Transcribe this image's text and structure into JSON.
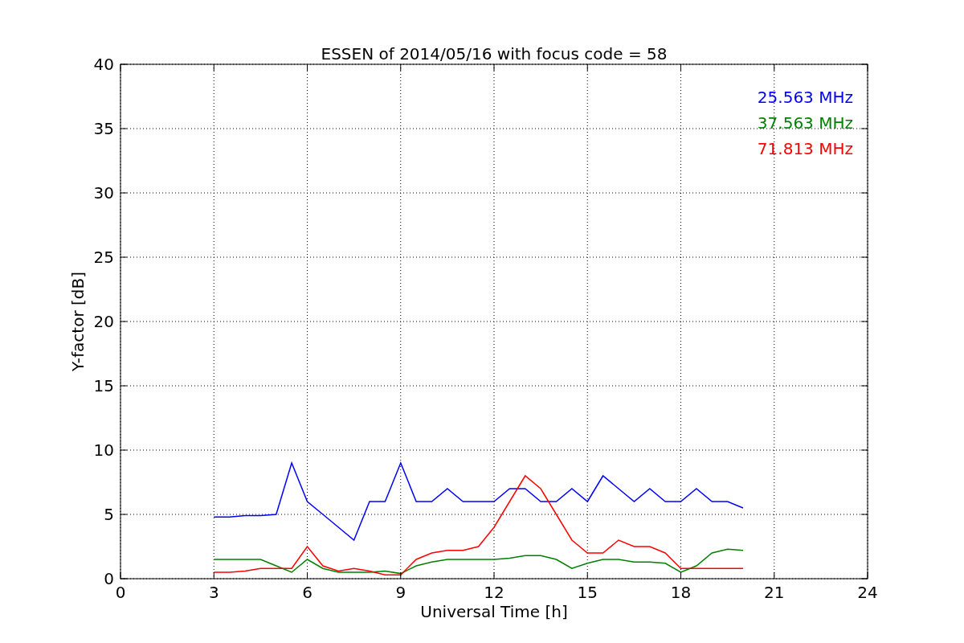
{
  "chart_data": {
    "type": "line",
    "title": "ESSEN of 2014/05/16 with focus code = 58",
    "xlabel": "Universal Time [h]",
    "ylabel": "Y-factor [dB]",
    "x": [
      3,
      3.5,
      4,
      4.5,
      5,
      5.5,
      6,
      6.5,
      7,
      7.5,
      8,
      8.5,
      9,
      9.5,
      10,
      10.5,
      11,
      11.5,
      12,
      12.5,
      13,
      13.5,
      14,
      14.5,
      15,
      15.5,
      16,
      16.5,
      17,
      17.5,
      18,
      18.5,
      19,
      19.5,
      20
    ],
    "series": [
      {
        "name": "25.563 MHz",
        "color": "#0000ff",
        "values": [
          4.8,
          4.8,
          4.9,
          4.9,
          5.0,
          9,
          6,
          5,
          4,
          3,
          6,
          6,
          9,
          6,
          6,
          7,
          6,
          6,
          6,
          7,
          7,
          6,
          6,
          7,
          6,
          8,
          7,
          6,
          7,
          6,
          6,
          7,
          6,
          6,
          5.5
        ]
      },
      {
        "name": "37.563 MHz",
        "color": "#008000",
        "values": [
          1.5,
          1.5,
          1.5,
          1.5,
          1.0,
          0.5,
          1.5,
          0.8,
          0.5,
          0.5,
          0.5,
          0.6,
          0.4,
          1.0,
          1.3,
          1.5,
          1.5,
          1.5,
          1.5,
          1.6,
          1.8,
          1.8,
          1.5,
          0.8,
          1.2,
          1.5,
          1.5,
          1.3,
          1.3,
          1.2,
          0.5,
          1.0,
          2.0,
          2.3,
          2.2
        ]
      },
      {
        "name": "71.813 MHz",
        "color": "#ff0000",
        "values": [
          0.5,
          0.5,
          0.6,
          0.8,
          0.8,
          0.8,
          2.5,
          1.0,
          0.6,
          0.8,
          0.6,
          0.3,
          0.3,
          1.5,
          2,
          2.2,
          2.2,
          2.5,
          4,
          6,
          8,
          7,
          5,
          3,
          2,
          2,
          3,
          2.5,
          2.5,
          2,
          0.8,
          0.8,
          0.8,
          0.8,
          0.8
        ]
      }
    ],
    "grid": true,
    "xlim": [
      0,
      24
    ],
    "ylim": [
      0,
      40
    ],
    "xticks": [
      0,
      3,
      6,
      9,
      12,
      15,
      18,
      21,
      24
    ],
    "yticks": [
      0,
      5,
      10,
      15,
      20,
      25,
      30,
      35,
      40
    ]
  }
}
